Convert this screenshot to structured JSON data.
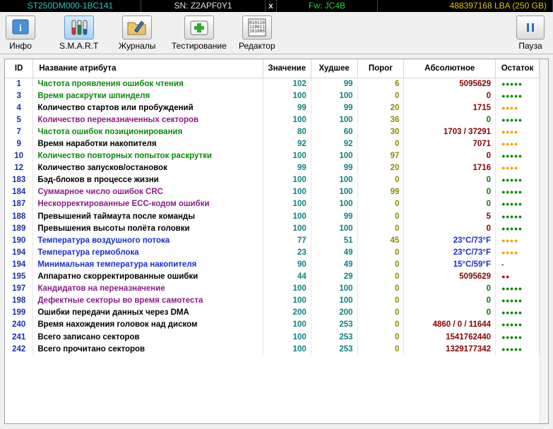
{
  "infobar": {
    "model": "ST250DM000-1BC141",
    "serial": "SN: Z2APF0Y1",
    "close": "x",
    "firmware": "Fw: JC4B",
    "capacity": "488397168 LBA (250 GB)"
  },
  "toolbar": {
    "info": "Инфо",
    "smart": "S.M.A.R.T",
    "logs": "Журналы",
    "testing": "Тестирование",
    "editor": "Редактор",
    "pause": "Пауза"
  },
  "table": {
    "headers": {
      "id": "ID",
      "name": "Название атрибута",
      "value": "Значение",
      "worst": "Худшее",
      "threshold": "Порог",
      "absolute": "Абсолютное",
      "remaining": "Остаток"
    },
    "rows": [
      {
        "id": "1",
        "name": "Частота проявления ошибок чтения",
        "value": "102",
        "worst": "99",
        "threshold": "6",
        "absolute": "5095629",
        "remaining": "●●●●●",
        "name_color": "green",
        "abs_color": "red",
        "dot_color": "green"
      },
      {
        "id": "3",
        "name": "Время раскрутки шпинделя",
        "value": "100",
        "worst": "100",
        "threshold": "0",
        "absolute": "0",
        "remaining": "●●●●●",
        "name_color": "green",
        "abs_color": "red",
        "dot_color": "green"
      },
      {
        "id": "4",
        "name": "Количество стартов или пробуждений",
        "value": "99",
        "worst": "99",
        "threshold": "20",
        "absolute": "1715",
        "remaining": "●●●●",
        "name_color": "black",
        "abs_color": "red",
        "dot_color": "orange"
      },
      {
        "id": "5",
        "name": "Количество переназначенных секторов",
        "value": "100",
        "worst": "100",
        "threshold": "36",
        "absolute": "0",
        "remaining": "●●●●●",
        "name_color": "purple",
        "abs_color": "green",
        "dot_color": "green"
      },
      {
        "id": "7",
        "name": "Частота ошибок позиционирования",
        "value": "80",
        "worst": "60",
        "threshold": "30",
        "absolute": "1703 / 37291",
        "remaining": "●●●●",
        "name_color": "green",
        "abs_color": "red",
        "dot_color": "orange"
      },
      {
        "id": "9",
        "name": "Время наработки накопителя",
        "value": "92",
        "worst": "92",
        "threshold": "0",
        "absolute": "7071",
        "remaining": "●●●●",
        "name_color": "black",
        "abs_color": "red",
        "dot_color": "orange"
      },
      {
        "id": "10",
        "name": "Количество повторных попыток раскрутки",
        "value": "100",
        "worst": "100",
        "threshold": "97",
        "absolute": "0",
        "remaining": "●●●●●",
        "name_color": "green",
        "abs_color": "red",
        "dot_color": "green"
      },
      {
        "id": "12",
        "name": "Количество запусков/остановок",
        "value": "99",
        "worst": "99",
        "threshold": "20",
        "absolute": "1716",
        "remaining": "●●●●",
        "name_color": "black",
        "abs_color": "red",
        "dot_color": "orange"
      },
      {
        "id": "183",
        "name": "Бэд-блоков в процессе жизни",
        "value": "100",
        "worst": "100",
        "threshold": "0",
        "absolute": "0",
        "remaining": "●●●●●",
        "name_color": "black",
        "abs_color": "green",
        "dot_color": "green"
      },
      {
        "id": "184",
        "name": "Суммарное число ошибок CRC",
        "value": "100",
        "worst": "100",
        "threshold": "99",
        "absolute": "0",
        "remaining": "●●●●●",
        "name_color": "purple",
        "abs_color": "green",
        "dot_color": "green"
      },
      {
        "id": "187",
        "name": "Нескорректированные ECC-кодом ошибки",
        "value": "100",
        "worst": "100",
        "threshold": "0",
        "absolute": "0",
        "remaining": "●●●●●",
        "name_color": "purple",
        "abs_color": "green",
        "dot_color": "green"
      },
      {
        "id": "188",
        "name": "Превышений таймаута после команды",
        "value": "100",
        "worst": "99",
        "threshold": "0",
        "absolute": "5",
        "remaining": "●●●●●",
        "name_color": "black",
        "abs_color": "red",
        "dot_color": "green"
      },
      {
        "id": "189",
        "name": "Превышения высоты полёта головки",
        "value": "100",
        "worst": "100",
        "threshold": "0",
        "absolute": "0",
        "remaining": "●●●●●",
        "name_color": "black",
        "abs_color": "red",
        "dot_color": "green"
      },
      {
        "id": "190",
        "name": "Температура воздушного потока",
        "value": "77",
        "worst": "51",
        "threshold": "45",
        "absolute": "23°C/73°F",
        "remaining": "●●●●",
        "name_color": "blue",
        "abs_color": "blue",
        "dot_color": "orange"
      },
      {
        "id": "194",
        "name": "Температура гермоблока",
        "value": "23",
        "worst": "49",
        "threshold": "0",
        "absolute": "23°C/73°F",
        "remaining": "●●●●",
        "name_color": "blue",
        "abs_color": "blue",
        "dot_color": "orange"
      },
      {
        "id": "194",
        "name": "Минимальная температура накопителя",
        "value": "90",
        "worst": "49",
        "threshold": "0",
        "absolute": "15°C/59°F",
        "remaining": "-",
        "name_color": "blue",
        "abs_color": "blue",
        "dot_color": "none"
      },
      {
        "id": "195",
        "name": "Аппаратно скорректированные ошибки",
        "value": "44",
        "worst": "29",
        "threshold": "0",
        "absolute": "5095629",
        "remaining": "●●",
        "name_color": "black",
        "abs_color": "red",
        "dot_color": "red"
      },
      {
        "id": "197",
        "name": "Кандидатов на переназначение",
        "value": "100",
        "worst": "100",
        "threshold": "0",
        "absolute": "0",
        "remaining": "●●●●●",
        "name_color": "purple",
        "abs_color": "green",
        "dot_color": "green"
      },
      {
        "id": "198",
        "name": "Дефектные секторы во время самотеста",
        "value": "100",
        "worst": "100",
        "threshold": "0",
        "absolute": "0",
        "remaining": "●●●●●",
        "name_color": "purple",
        "abs_color": "green",
        "dot_color": "green"
      },
      {
        "id": "199",
        "name": "Ошибки передачи данных через DMA",
        "value": "200",
        "worst": "200",
        "threshold": "0",
        "absolute": "0",
        "remaining": "●●●●●",
        "name_color": "black",
        "abs_color": "green",
        "dot_color": "green"
      },
      {
        "id": "240",
        "name": "Время нахождения головок над диском",
        "value": "100",
        "worst": "253",
        "threshold": "0",
        "absolute": "4860 / 0 / 11644",
        "remaining": "●●●●●",
        "name_color": "black",
        "abs_color": "red",
        "dot_color": "green"
      },
      {
        "id": "241",
        "name": "Всего записано секторов",
        "value": "100",
        "worst": "253",
        "threshold": "0",
        "absolute": "1541762440",
        "remaining": "●●●●●",
        "name_color": "black",
        "abs_color": "red",
        "dot_color": "green"
      },
      {
        "id": "242",
        "name": "Всего прочитано секторов",
        "value": "100",
        "worst": "253",
        "threshold": "0",
        "absolute": "1329177342",
        "remaining": "●●●●●",
        "name_color": "black",
        "abs_color": "red",
        "dot_color": "green"
      }
    ]
  },
  "colors": {
    "name_green": "#0a8a0a",
    "name_purple": "#8b1a8b",
    "name_blue": "#1a2fd0",
    "abs_red": "#8b0000",
    "dot_green": "#0a8a0a",
    "dot_orange": "#f0a000",
    "dot_red": "#d00000",
    "value_teal": "#128080",
    "threshold_olive": "#8a8a00"
  }
}
